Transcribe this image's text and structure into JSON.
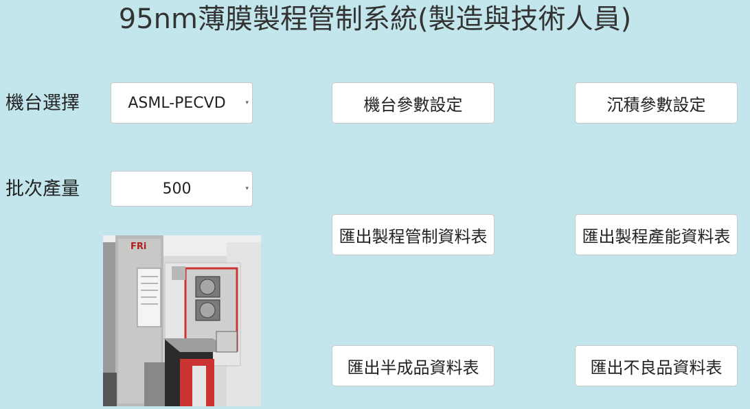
{
  "title": "95nm薄膜製程管制系統(製造與技術人員)",
  "machine": {
    "label": "機台選擇",
    "value": "ASML-PECVD"
  },
  "batch": {
    "label": "批次產量",
    "value": "500"
  },
  "buttons": {
    "machine_params": "機台參數設定",
    "deposition_params": "沉積參數設定",
    "export_process_control": "匯出製程管制資料表",
    "export_capacity": "匯出製程產能資料表",
    "export_semi_finished": "匯出半成品資料表",
    "export_defective": "匯出不良品資料表"
  },
  "photo": {
    "brand_mark": "FRi"
  }
}
